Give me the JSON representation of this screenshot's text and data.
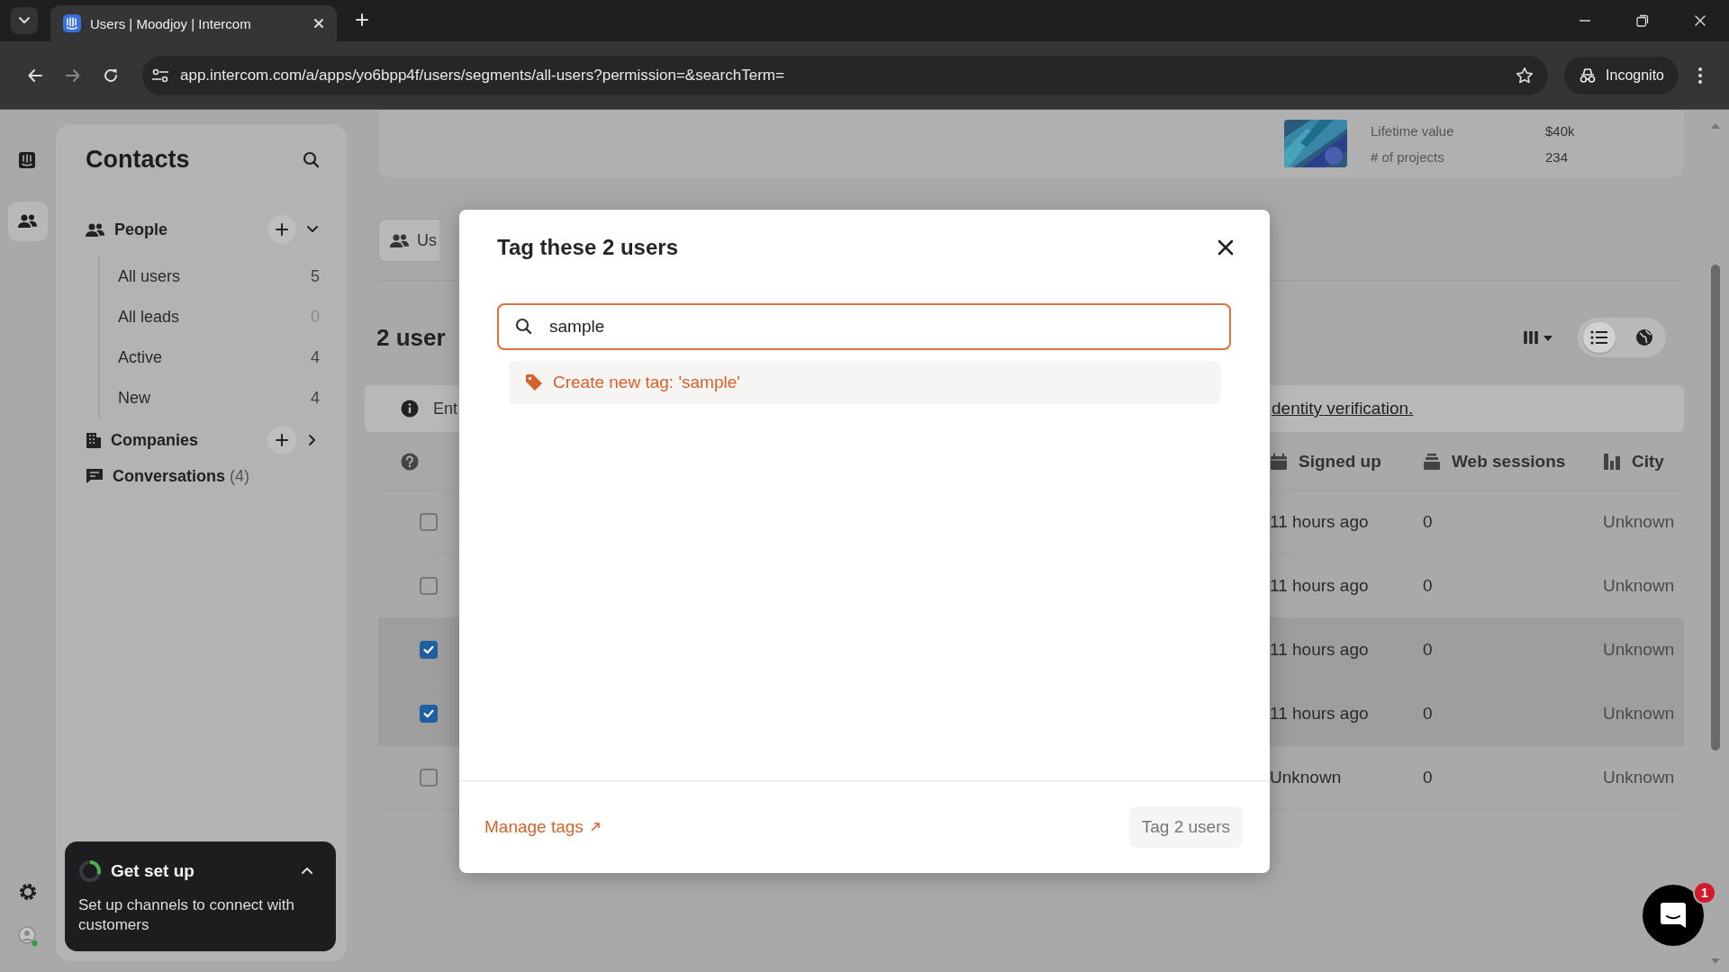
{
  "browser": {
    "tab": {
      "title": "Users | Moodjoy | Intercom",
      "selected": true
    },
    "url": "app.intercom.com/a/apps/yo6bpp4f/users/segments/all-users?permission=&searchTerm=",
    "profile": "Incognito"
  },
  "rail": {
    "items": [
      {
        "kind": "inbox",
        "selected": false
      },
      {
        "kind": "contacts",
        "selected": true
      }
    ]
  },
  "sidebar": {
    "title": "Contacts",
    "sections": [
      {
        "kind": "people",
        "label": "People",
        "expanded": true,
        "children": [
          {
            "label": "All users",
            "count": "5",
            "muted": false
          },
          {
            "label": "All leads",
            "count": "0",
            "muted": true
          },
          {
            "label": "Active",
            "count": "4",
            "muted": false
          },
          {
            "label": "New",
            "count": "4",
            "muted": false
          }
        ]
      },
      {
        "kind": "companies",
        "label": "Companies",
        "expanded": false
      },
      {
        "kind": "conversations",
        "label": "Conversations",
        "count": "(4)"
      }
    ]
  },
  "setup_card": {
    "title": "Get set up",
    "text": "Set up channels to connect with customers",
    "expanded": true
  },
  "profile_card": {
    "rows": [
      {
        "label": "Lifetime value",
        "value": "$40k"
      },
      {
        "label": "# of projects",
        "value": "234"
      }
    ]
  },
  "main": {
    "view_tab": "Us",
    "heading": "2 user",
    "views": [
      {
        "kind": "list",
        "selected": true
      },
      {
        "kind": "map",
        "selected": false
      }
    ],
    "banner": {
      "text": "Ent",
      "link": "dentity verification."
    },
    "table": {
      "columns": [
        {
          "kind": "calendar",
          "label": "Signed up"
        },
        {
          "kind": "stack",
          "label": "Web sessions"
        },
        {
          "kind": "chart",
          "label": "City"
        }
      ],
      "rows": [
        {
          "selected": false,
          "cells": [
            "11 hours ago",
            "0",
            "Unknown"
          ]
        },
        {
          "selected": false,
          "cells": [
            "11 hours ago",
            "0",
            "Unknown"
          ]
        },
        {
          "selected": true,
          "cells": [
            "11 hours ago",
            "0",
            "Unknown"
          ]
        },
        {
          "selected": true,
          "cells": [
            "11 hours ago",
            "0",
            "Unknown"
          ]
        },
        {
          "selected": false,
          "cells": [
            "Unknown",
            "0",
            "Unknown"
          ]
        }
      ]
    }
  },
  "modal": {
    "title": "Tag these 2 users",
    "search": {
      "value": "sample"
    },
    "suggestion": "Create new tag: 'sample'",
    "manage_link": "Manage tags",
    "submit": {
      "label": "Tag 2 users",
      "disabled": true
    }
  },
  "messenger": {
    "badge": "1"
  }
}
